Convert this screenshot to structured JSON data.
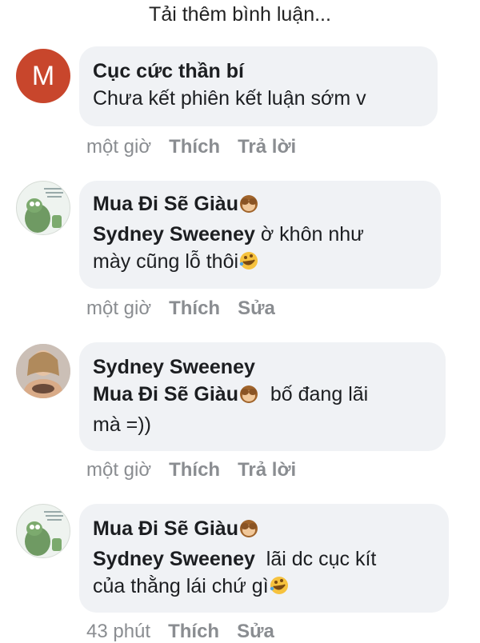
{
  "load_more": "Tải thêm bình luận...",
  "comments": [
    {
      "avatar_letter": "M",
      "author": "Cục cức thần bí",
      "tag": "",
      "text": "Chưa kết phiên kết luận sớm v",
      "time": "một giờ",
      "like": "Thích",
      "action": "Trả lời"
    },
    {
      "author": "Mua Đi Sẽ Giàu",
      "tag": "Sydney Sweeney",
      "text_line1": " ờ khôn  như",
      "text_line2": "mày cũng lỗ thôi",
      "time": "một giờ",
      "like": "Thích",
      "action": "Sửa"
    },
    {
      "author": "Sydney Sweeney",
      "tag": "Mua Đi Sẽ Giàu",
      "text_line1": "  bố đang lãi",
      "text_line2": "mà =))",
      "time": "một giờ",
      "like": "Thích",
      "action": "Trả lời"
    },
    {
      "author": "Mua Đi Sẽ Giàu",
      "tag": "Sydney Sweeney",
      "text_line1": "  lãi dc cục kít",
      "text_line2": "của thằng lái chứ gì",
      "time": "43 phút",
      "like": "Thích",
      "action": "Sửa"
    }
  ],
  "icons": {
    "see_no_evil": "see-no-evil-monkey-emoji",
    "rofl": "rolling-laughing-emoji"
  }
}
